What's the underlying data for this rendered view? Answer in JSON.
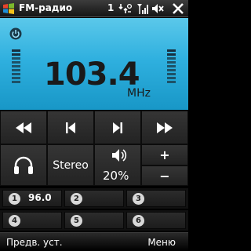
{
  "statusbar": {
    "app_title": "FM-радио",
    "notification_count": "1",
    "icons": [
      "windows-logo",
      "connectivity-icon",
      "signal-icon",
      "speaker-muted-icon",
      "close-icon"
    ]
  },
  "display": {
    "frequency": "103.4",
    "unit": "MHz",
    "power_icon": "power-icon"
  },
  "controls": {
    "rewind_icon": "rewind-icon",
    "prev_icon": "skip-previous-icon",
    "next_icon": "skip-next-icon",
    "forward_icon": "fast-forward-icon",
    "headphones_icon": "headphones-icon",
    "stereo_label": "Stereo",
    "volume_icon": "volume-icon",
    "volume_text": "20%",
    "volume_level": 0.2,
    "plus_label": "+",
    "minus_label": "−"
  },
  "presets": [
    {
      "number": "1",
      "freq": "96.0"
    },
    {
      "number": "2",
      "freq": ""
    },
    {
      "number": "3",
      "freq": ""
    },
    {
      "number": "4",
      "freq": ""
    },
    {
      "number": "5",
      "freq": ""
    },
    {
      "number": "6",
      "freq": ""
    }
  ],
  "softkeys": {
    "left": "Предв. уст.",
    "right": "Меню"
  },
  "colors": {
    "display_bg": "#2fb0df",
    "button_bg": "#2c2c2c",
    "text": "#ffffff"
  }
}
